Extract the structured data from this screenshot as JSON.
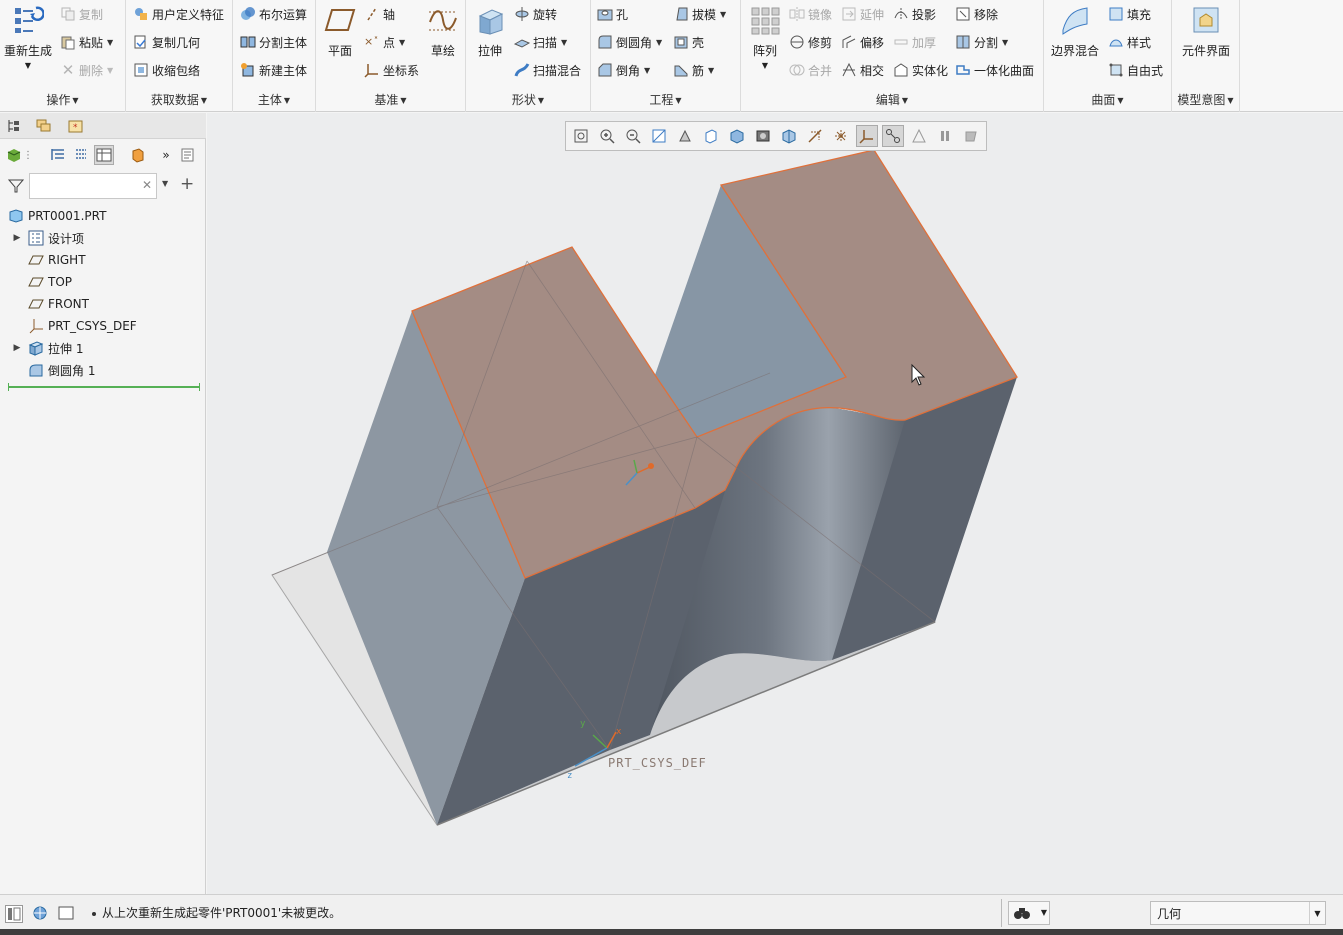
{
  "ribbon": {
    "operations": {
      "label": "操作",
      "regenerate": "重新生成",
      "copy": "复制",
      "paste": "粘贴",
      "delete": "删除"
    },
    "get_data": {
      "label": "获取数据",
      "udf": "用户定义特征",
      "copy_geometry": "复制几何",
      "shrinkwrap": "收缩包络"
    },
    "body": {
      "label": "主体",
      "boolean": "布尔运算",
      "split_body": "分割主体",
      "new_body": "新建主体"
    },
    "datum": {
      "label": "基准",
      "plane": "平面",
      "axis": "轴",
      "point": "点",
      "csys": "坐标系",
      "sketch": "草绘"
    },
    "shapes": {
      "label": "形状",
      "extrude": "拉伸",
      "revolve": "旋转",
      "sweep": "扫描",
      "swept_blend": "扫描混合"
    },
    "engineering": {
      "label": "工程",
      "hole": "孔",
      "round": "倒圆角",
      "chamfer": "倒角",
      "draft": "拔模",
      "shell": "壳",
      "rib": "筋"
    },
    "editing": {
      "label": "编辑",
      "pattern": "阵列",
      "mirror": "镜像",
      "trim": "修剪",
      "merge": "合并",
      "extend": "延伸",
      "offset": "偏移",
      "intersect": "相交",
      "project": "投影",
      "thicken": "加厚",
      "solidify": "实体化",
      "remove": "移除",
      "split": "分割",
      "unify_surface": "一体化曲面"
    },
    "surfaces": {
      "label": "曲面",
      "boundary_blend": "边界混合",
      "fill": "填充",
      "style": "样式",
      "freestyle": "自由式"
    },
    "model_intent": {
      "label": "模型意图",
      "component_interface": "元件界面"
    }
  },
  "model_tree": {
    "search_placeholder": "",
    "items": [
      {
        "label": "PRT0001.PRT"
      },
      {
        "label": "设计项"
      },
      {
        "label": "RIGHT"
      },
      {
        "label": "TOP"
      },
      {
        "label": "FRONT"
      },
      {
        "label": "PRT_CSYS_DEF"
      },
      {
        "label": "拉伸 1"
      },
      {
        "label": "倒圆角 1"
      }
    ]
  },
  "viewport": {
    "csys_label": "PRT_CSYS_DEF",
    "colors": {
      "top_face": "#a48c84",
      "side_face": "#8896a4",
      "dark_face": "#5b626d",
      "highlight": "#e0703a"
    }
  },
  "statusbar": {
    "message": "从上次重新生成起零件'PRT0001'未被更改。",
    "filter_value": "几何"
  }
}
